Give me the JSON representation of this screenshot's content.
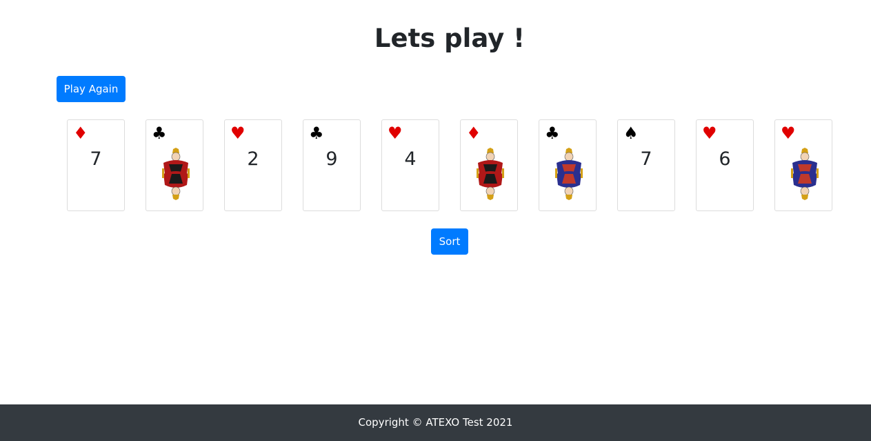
{
  "header": {
    "title": "Lets play !"
  },
  "buttons": {
    "play_again": "Play Again",
    "sort": "Sort"
  },
  "colors": {
    "primary": "#007bff",
    "red_suit": "#e00000",
    "black_suit": "#000000",
    "footer_bg": "#343a40"
  },
  "cards": [
    {
      "suit": "♦",
      "suit_name": "diamond",
      "color": "red",
      "rank": "7",
      "face": false
    },
    {
      "suit": "♣",
      "suit_name": "club",
      "color": "black",
      "rank": "",
      "face": true,
      "face_palette": "red"
    },
    {
      "suit": "♥",
      "suit_name": "heart",
      "color": "red",
      "rank": "2",
      "face": false
    },
    {
      "suit": "♣",
      "suit_name": "club",
      "color": "black",
      "rank": "9",
      "face": false
    },
    {
      "suit": "♥",
      "suit_name": "heart",
      "color": "red",
      "rank": "4",
      "face": false
    },
    {
      "suit": "♦",
      "suit_name": "diamond",
      "color": "red",
      "rank": "",
      "face": true,
      "face_palette": "red"
    },
    {
      "suit": "♣",
      "suit_name": "club",
      "color": "black",
      "rank": "",
      "face": true,
      "face_palette": "blue"
    },
    {
      "suit": "♠",
      "suit_name": "spade",
      "color": "black",
      "rank": "7",
      "face": false
    },
    {
      "suit": "♥",
      "suit_name": "heart",
      "color": "red",
      "rank": "6",
      "face": false
    },
    {
      "suit": "♥",
      "suit_name": "heart",
      "color": "red",
      "rank": "",
      "face": true,
      "face_palette": "blue"
    }
  ],
  "footer": {
    "text": "Copyright © ATEXO Test 2021"
  }
}
